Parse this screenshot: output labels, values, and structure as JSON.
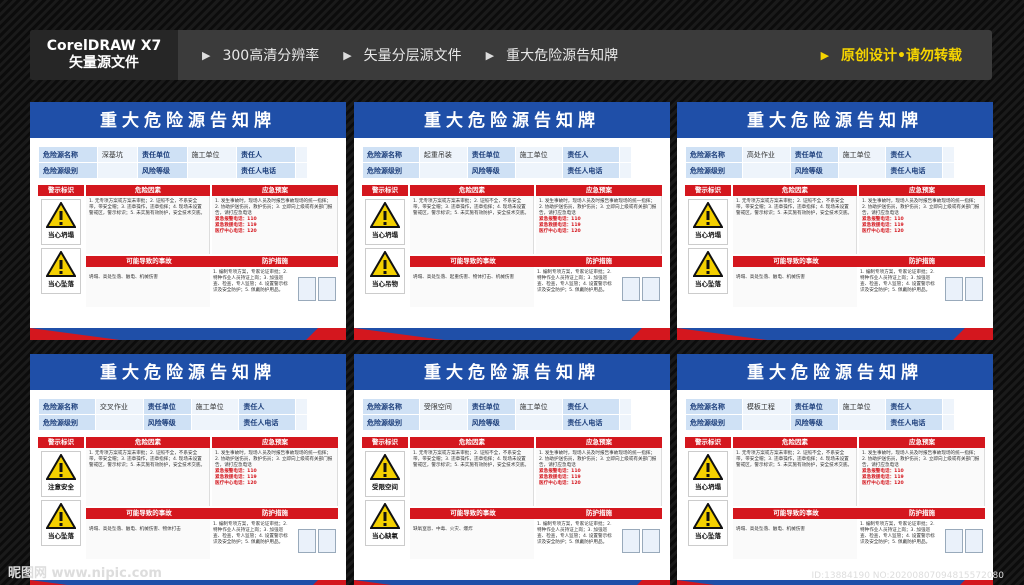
{
  "topbar": {
    "brand_line1": "CorelDRAW X7",
    "brand_line2": "矢量源文件",
    "features": [
      "300高清分辨率",
      "矢量分层源文件",
      "重大危险源告知牌"
    ],
    "highlight": "原创设计•请勿转载",
    "highlight_color": "#f5d400"
  },
  "colors": {
    "blue": "#1f4fa8",
    "red": "#d4171e"
  },
  "board_common": {
    "title": "重大危险源告知牌",
    "k_name": "危险源名称",
    "k_level": "危险源级别",
    "k_unit": "责任单位",
    "k_risk": "风险等级",
    "k_unit_val": "施工单位",
    "k_person": "责任人",
    "k_phone": "责任人电话",
    "h_warn": "警示标识",
    "h_factor": "危险因素",
    "h_plan": "应急预案",
    "h_accident": "可能导致的事故",
    "h_measure": "防护措施",
    "factor_text": "1. 无专项方案或方案未审批；2. 证照不全，不系安全带，带安全帽；3. 违章操作，违章指挥；4. 现场未设置警戒区，警示标识；5. 未实施有效防护，安全技术交底。",
    "plan_text": "1. 发生事故时，现场人员及时报告事故现场的统一指挥；2. 协助护送伤员，救护伤员；3. 立即向上级或有关部门报告，请打应急电话",
    "plan_phones": [
      "紧急报警电话：110",
      "紧急救援电话：119",
      "医疗中心电话：120"
    ],
    "measure_text": "1. 编制专项方案，专家论证审批；2. 特种作业人员持证上岗；3. 加强巡查、检查，专人监管；4. 设置警示标识及安全防护；5. 佩戴防护用品。"
  },
  "boards": [
    {
      "name": "深基坑",
      "signs": [
        "当心坍塌",
        "当心坠落"
      ],
      "accident": "坍塌、高处坠落、触电、机械伤害"
    },
    {
      "name": "起重吊装",
      "signs": [
        "当心坍塌",
        "当心吊物"
      ],
      "accident": "坍塌、高处坠落、起重伤害、物体打击、机械伤害"
    },
    {
      "name": "高处作业",
      "signs": [
        "当心坍塌",
        "当心坠落"
      ],
      "accident": "坍塌、高处坠落、触电、机械伤害"
    },
    {
      "name": "交叉作业",
      "signs": [
        "注意安全",
        "当心坠落"
      ],
      "accident": "坍塌、高处坠落、触电、机械伤害、物体打击"
    },
    {
      "name": "受限空间",
      "signs": [
        "受限空间",
        "当心缺氧"
      ],
      "accident": "缺氧窒息、中毒、火灾、爆炸"
    },
    {
      "name": "模板工程",
      "signs": [
        "当心坍塌",
        "当心坠落"
      ],
      "accident": "坍塌、高处坠落、触电、机械伤害"
    }
  ],
  "watermark_left": "昵图网 www.nipic.com",
  "watermark_right": "ID:13884190 NO:20200807094815572080"
}
